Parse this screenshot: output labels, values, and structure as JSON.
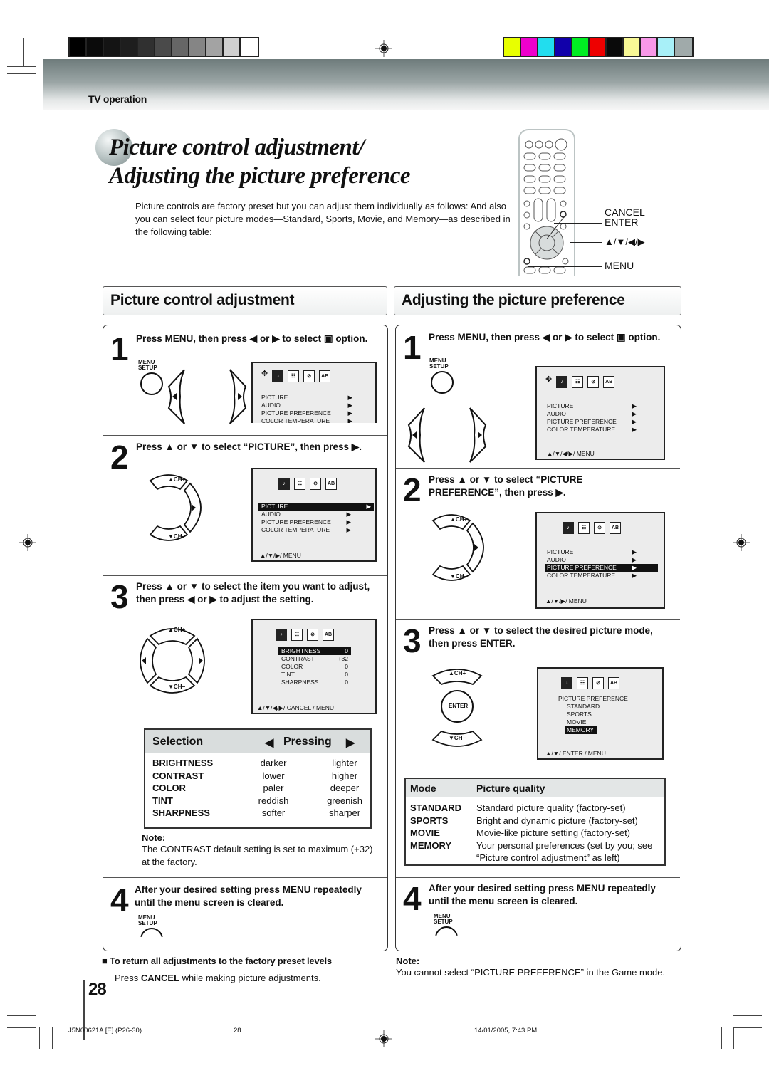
{
  "print_marks": {
    "gray_swatches": [
      "#000000",
      "#0b0b0b",
      "#141414",
      "#1e1e1e",
      "#303030",
      "#4a4a4a",
      "#666666",
      "#858585",
      "#a3a3a3",
      "#d0d0d0",
      "#ffffff"
    ],
    "color_swatches": [
      "#e8ff00",
      "#ee00cc",
      "#22ddee",
      "#1100aa",
      "#00ee22",
      "#ee0000",
      "#0a0a0a",
      "#f8f896",
      "#f898e8",
      "#a8f0f8",
      "#a0aaaa"
    ]
  },
  "header": {
    "section": "TV operation",
    "title_line1": "Picture control adjustment/",
    "title_line2": "Adjusting the picture preference",
    "intro": "Picture controls are factory preset but you can adjust them individually as follows: And also you can select four picture modes—Standard, Sports, Movie, and Memory—as described in the following table:"
  },
  "remote": {
    "labels": {
      "cancel": "CANCEL",
      "enter": "ENTER",
      "arrows": "▲/▼/◀/▶",
      "menu": "MENU"
    }
  },
  "left": {
    "heading": "Picture control adjustment",
    "steps": [
      {
        "num": "1",
        "text": "Press MENU, then press ◀ or ▶ to select ▣ option.",
        "menu_label": "MENU\nSETUP",
        "osd": {
          "items": [
            "PICTURE",
            "AUDIO",
            "PICTURE  PREFERENCE",
            "COLOR  TEMPERATURE"
          ],
          "arrow": "▶"
        }
      },
      {
        "num": "2",
        "text": "Press ▲ or ▼ to select “PICTURE”, then press ▶.",
        "ch_plus": "▲CH+",
        "ch_minus": "▼CH−",
        "osd": {
          "items": [
            "PICTURE",
            "AUDIO",
            "PICTURE  PREFERENCE",
            "COLOR  TEMPERATURE"
          ],
          "selected": "PICTURE",
          "arrow": "▶",
          "footer": "▲/▼/▶/ MENU"
        }
      },
      {
        "num": "3",
        "text": "Press ▲ or ▼ to select the item you want to adjust, then press ◀ or ▶ to adjust the setting.",
        "ch_plus": "▲CH+",
        "ch_minus": "▼CH−",
        "osd": {
          "items": [
            {
              "name": "BRIGHTNESS",
              "value": "0"
            },
            {
              "name": "CONTRAST",
              "value": "+32"
            },
            {
              "name": "COLOR",
              "value": "0"
            },
            {
              "name": "TINT",
              "value": "0"
            },
            {
              "name": "SHARPNESS",
              "value": "0"
            }
          ],
          "selected": "BRIGHTNESS",
          "footer": "▲/▼/◀/▶/ CANCEL / MENU"
        }
      },
      {
        "num": "4",
        "text": "After your desired setting press MENU repeatedly until the menu screen is cleared.",
        "menu_label": "MENU\nSETUP"
      }
    ],
    "selection_table": {
      "col_selection": "Selection",
      "col_pressing": "Pressing",
      "left_arrow": "◀",
      "right_arrow": "▶",
      "rows": [
        {
          "item": "BRIGHTNESS",
          "left": "darker",
          "right": "lighter"
        },
        {
          "item": "CONTRAST",
          "left": "lower",
          "right": "higher"
        },
        {
          "item": "COLOR",
          "left": "paler",
          "right": "deeper"
        },
        {
          "item": "TINT",
          "left": "reddish",
          "right": "greenish"
        },
        {
          "item": "SHARPNESS",
          "left": "softer",
          "right": "sharper"
        }
      ]
    },
    "note_title": "Note:",
    "note_text": "The CONTRAST default setting is set to maximum (+32) at the factory."
  },
  "right": {
    "heading": "Adjusting the picture preference",
    "steps": [
      {
        "num": "1",
        "text": "Press MENU, then press ◀ or ▶ to select ▣ option.",
        "menu_label": "MENU\nSETUP",
        "osd": {
          "items": [
            "PICTURE",
            "AUDIO",
            "PICTURE  PREFERENCE",
            "COLOR  TEMPERATURE"
          ],
          "arrow": "▶",
          "footer": "▲/▼/◀/▶/ MENU"
        }
      },
      {
        "num": "2",
        "text": "Press ▲ or ▼ to select “PICTURE PREFERENCE”, then press ▶.",
        "ch_plus": "▲CH+",
        "ch_minus": "▼CH−",
        "osd": {
          "items": [
            "PICTURE",
            "AUDIO",
            "PICTURE  PREFERENCE",
            "COLOR  TEMPERATURE"
          ],
          "selected": "PICTURE  PREFERENCE",
          "arrow": "▶",
          "footer": "▲/▼/▶/ MENU"
        }
      },
      {
        "num": "3",
        "text": "Press ▲ or ▼ to select the desired picture mode, then press ENTER.",
        "ch_plus": "▲CH+",
        "ch_minus": "▼CH−",
        "enter": "ENTER",
        "osd": {
          "title": "PICTURE PREFERENCE",
          "items": [
            "STANDARD",
            "SPORTS",
            "MOVIE",
            "MEMORY"
          ],
          "selected": "MEMORY",
          "footer": "▲/▼/ ENTER / MENU"
        }
      },
      {
        "num": "4",
        "text": "After your desired setting press MENU repeatedly until the menu screen is cleared.",
        "menu_label": "MENU\nSETUP"
      }
    ],
    "mode_table": {
      "col_mode": "Mode",
      "col_quality": "Picture quality",
      "rows": [
        {
          "mode": "STANDARD",
          "quality": "Standard picture quality (factory-set)"
        },
        {
          "mode": "SPORTS",
          "quality": "Bright and dynamic picture (factory-set)"
        },
        {
          "mode": "MOVIE",
          "quality": "Movie-like picture setting (factory-set)"
        },
        {
          "mode": "MEMORY",
          "quality": "Your personal preferences (set by you; see “Picture control adjustment” as left)"
        }
      ]
    }
  },
  "footer": {
    "reset_heading": "To return all adjustments to the factory preset levels",
    "reset_text_pre": "Press ",
    "reset_text_bold": "CANCEL",
    "reset_text_post": " while making picture adjustments.",
    "note_title": "Note:",
    "note_text": "You cannot select “PICTURE PREFERENCE” in the Game mode.",
    "page_number": "28",
    "doc_code": "J5N00621A [E] (P26-30)",
    "doc_page": "28",
    "timestamp": "14/01/2005, 7:43 PM"
  }
}
